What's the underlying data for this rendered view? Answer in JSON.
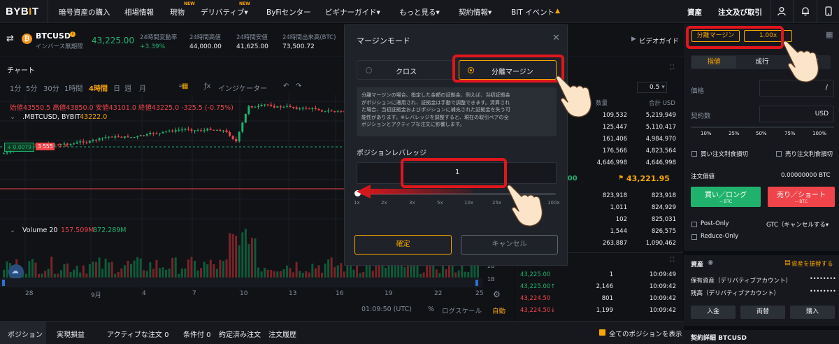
{
  "nav": {
    "logo_a": "BYB",
    "logo_b": "I",
    "logo_c": "T",
    "items": [
      "暗号資産の購入",
      "相場情報",
      "現物",
      "デリバティブ▾",
      "ByFiセンター",
      "ビギナーガイド▾",
      "もっと見る▾",
      "契約情報▾",
      "BIT イベント"
    ],
    "new_tag": "NEW",
    "assets": "資産",
    "orders": "注文及び取引"
  },
  "ticker": {
    "symbol": "BTCUSD",
    "subtitle": "インバース無期限",
    "price": "43,225.00",
    "change_label": "24時間変動率",
    "change_value": "+3.39%",
    "high_label": "24時間高値",
    "high_value": "44,000.00",
    "low_label": "24時間安値",
    "low_value": "41,625.00",
    "turnover_label": "24時間出来高(BTC)",
    "turnover_value": "73,500.72",
    "video_guide": "ビデオガイド"
  },
  "chart": {
    "title": "チャート",
    "timeframes": [
      "1分",
      "5分",
      "30分",
      "1時間",
      "4時間",
      "日",
      "週",
      "月"
    ],
    "active_timeframe": "4時間",
    "indicator": "インジケーター",
    "ohlc": "始値43550.5 高値43850.0 安値43101.0 終値43225.0 -325.5 (-0.75%)",
    "series_name": ".MBTCUSD, BYBIT",
    "series_value": "43222.0",
    "badge_left": "+ 0.0079",
    "badge_right": "3 555",
    "volume_label": "Volume 20",
    "volume_v1": "157.509M",
    "volume_v2": "872.289M",
    "vol_axis_top": "2B",
    "vol_axis_bottom": "1B",
    "dates": [
      "28",
      "9月",
      "4",
      "7",
      "10",
      "13",
      "16",
      "19",
      "22",
      "25"
    ],
    "time_utc": "01:09:50 (UTC)",
    "pct": "%",
    "log_scale": "ログスケール",
    "auto": "自動",
    "colors": {
      "up": "#20b26c",
      "down": "#ef454a",
      "accent": "#f7a600"
    }
  },
  "orderbook": {
    "col_qty": "数量",
    "col_total": "合計 USD",
    "step": "0.5",
    "asks": [
      {
        "qty": "109,532",
        "total": "5,219,949"
      },
      {
        "qty": "125,447",
        "total": "5,110,417"
      },
      {
        "qty": "161,406",
        "total": "4,984,970"
      },
      {
        "qty": "176,566",
        "total": "4,823,564"
      },
      {
        "qty": "4,646,998",
        "total": "4,646,998"
      }
    ],
    "mid_price": "43,221.95",
    "mid_left": ".00",
    "bids": [
      {
        "qty": "823,918",
        "total": "823,918"
      },
      {
        "qty": "1,011",
        "total": "824,929"
      },
      {
        "qty": "102",
        "total": "825,031"
      },
      {
        "qty": "1,544",
        "total": "826,575"
      },
      {
        "qty": "263,887",
        "total": "1,090,462"
      }
    ],
    "trades": [
      {
        "price": "43,225.00",
        "qty": "1",
        "time": "10:09:49",
        "dir": "up"
      },
      {
        "price": "43,225.00↑",
        "qty": "2,146",
        "time": "10:09:42",
        "dir": "up"
      },
      {
        "price": "43,224.50",
        "qty": "801",
        "time": "10:09:42",
        "dir": "down"
      },
      {
        "price": "43,224.50↓",
        "qty": "1,199",
        "time": "10:09:42",
        "dir": "down"
      }
    ]
  },
  "orderpanel": {
    "isolated": "分離マージン",
    "leverage": "1.00x",
    "tabs": [
      "指値",
      "成行",
      "条件付"
    ],
    "price_label": "価格",
    "qty_label": "契約数",
    "qty_unit": "USD",
    "pcts": [
      "10%",
      "25%",
      "50%",
      "75%",
      "100%"
    ],
    "tp_buy": "買い注文利食損切",
    "tp_sell": "売り注文利食損切",
    "order_value_label": "注文価値",
    "order_value": "0.00000000 BTC",
    "buy_label": "買い／ロング",
    "buy_sub": "-- BTC",
    "sell_label": "売り／ショート",
    "sell_sub": "-- BTC",
    "post_only": "Post-Only",
    "gtc": "GTC（キャンセルする▾",
    "reduce_only": "Reduce-Only",
    "assets": "資産",
    "transfer": "資産を振替する",
    "held_assets": "保有資産（デリバティブアカウント）",
    "balance_label": "残高（デリバティブアカウント）",
    "masked": "••••••••",
    "deposit": "入金",
    "exchange": "両替",
    "buy_crypto": "購入",
    "contract_details": "契約詳細 BTCUSD"
  },
  "bottom": {
    "tabs": [
      "ポジション",
      "実現損益",
      "アクティブな注文 0",
      "条件付 0",
      "約定済み注文",
      "注文履歴"
    ],
    "show_all": "全てのポジションを表示"
  },
  "modal": {
    "title": "マージンモード",
    "cross": "クロス",
    "isolated": "分離マージン",
    "description": "分離マージンの場合、指定した金額の証拠金、例えば、当初証拠金がポジションに適用され、証拠金は手動で調整できます。清算された場合、当初証拠金およびポジションに補充された証拠金を失う可能性があります。※レバレッジを調整すると、現在の取引ペアの全ポジションとアクティブな注文に影響します。",
    "desc_lines": [
      "分離マージンの場合、指定した金額の証拠金、例えば、当初証拠金",
      "がポジションに適用され、証拠金は手動で調整できます。清算され",
      "た場合、当初証拠金およびポジションに補充された証拠金を失う可",
      "能性があります。※レバレッジを調整すると、現在の取引ペアの全",
      "ポジションとアクティブな注文に影響します。"
    ],
    "leverage_label": "ポジションレバレッジ",
    "leverage_value": "1",
    "slider_marks": [
      "1x",
      "2x",
      "3x",
      "5x",
      "10x",
      "25x",
      "100x"
    ],
    "confirm": "確定",
    "cancel": "キャンセル"
  }
}
